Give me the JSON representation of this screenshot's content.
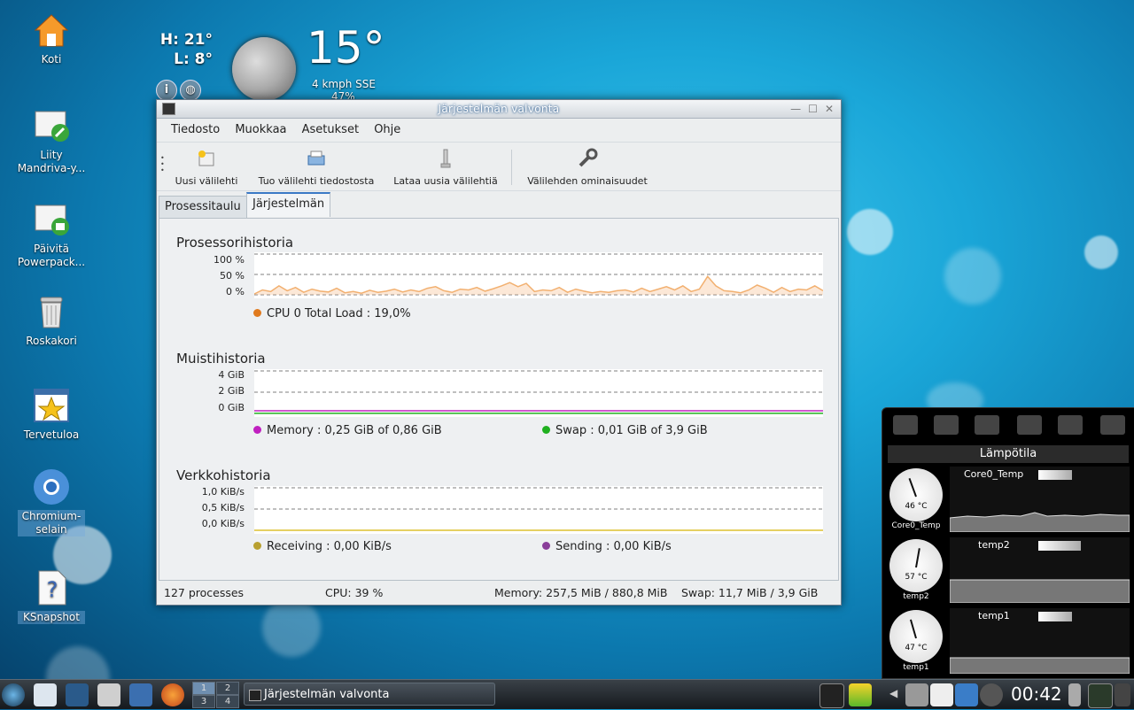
{
  "desktop": {
    "icons": [
      {
        "label": "Koti"
      },
      {
        "label": "Liity\nMandriva-y..."
      },
      {
        "label": "Päivitä\nPowerpack..."
      },
      {
        "label": "Roskakori"
      },
      {
        "label": "Tervetuloa"
      },
      {
        "label": "Chromium-\nselain"
      },
      {
        "label": "KSnapshot"
      }
    ]
  },
  "weather": {
    "high": "H: 21°",
    "low": "L: 8°",
    "temperature": "15°",
    "wind": "4 kmph SSE",
    "humidity": "47%"
  },
  "window": {
    "title": "Järjestelmän valvonta",
    "menu": [
      "Tiedosto",
      "Muokkaa",
      "Asetukset",
      "Ohje"
    ],
    "toolbar": {
      "new_tab": "Uusi välilehti",
      "import_tab": "Tuo välilehti tiedostosta",
      "download_tabs": "Lataa uusia välilehtiä",
      "tab_properties": "Välilehden ominaisuudet"
    },
    "tabs": [
      "Prosessitaulu",
      "Järjestelmän kuorma"
    ],
    "active_tab": "Järjestelmän kuorma",
    "cpu": {
      "title": "Prosessorihistoria",
      "y_labels": [
        "100 %",
        "50 %",
        "0 %"
      ],
      "legend": "CPU 0 Total Load : 19,0%",
      "color": "#e07a1e"
    },
    "memory": {
      "title": "Muistihistoria",
      "y_labels": [
        "4 GiB",
        "2 GiB",
        "0 GiB"
      ],
      "legend_memory": "Memory : 0,25 GiB of 0,86 GiB",
      "legend_swap": "Swap : 0,01 GiB of 3,9 GiB",
      "memory_color": "#c020c0",
      "swap_color": "#20b020"
    },
    "network": {
      "title": "Verkkohistoria",
      "y_labels": [
        "1,0 KiB/s",
        "0,5 KiB/s",
        "0,0 KiB/s"
      ],
      "legend_receiving": "Receiving : 0,00 KiB/s",
      "legend_sending": "Sending : 0,00 KiB/s",
      "receiving_color": "#b8a030",
      "sending_color": "#8a3e9a"
    },
    "status": {
      "processes": "127 processes",
      "cpu": "CPU: 39 %",
      "memory": "Memory: 257,5 MiB / 880,8 MiB",
      "swap": "Swap: 11,7 MiB / 3,9 GiB"
    }
  },
  "sensors": {
    "title": "Lämpötila",
    "items": [
      {
        "name": "Core0_Temp",
        "value": "46 °C",
        "label": "Core0_Temp"
      },
      {
        "name": "temp2",
        "value": "57 °C",
        "label": "temp2"
      },
      {
        "name": "temp1",
        "value": "47 °C",
        "label": "temp1"
      }
    ]
  },
  "taskbar": {
    "pager": [
      "1",
      "2",
      "3",
      "4"
    ],
    "task": "Järjestelmän valvonta",
    "clock": "00:42"
  },
  "chart_data": [
    {
      "type": "area",
      "title": "Prosessorihistoria",
      "ylabel": "",
      "ylim": [
        0,
        100
      ],
      "series": [
        {
          "name": "CPU 0 Total Load",
          "values": [
            2,
            12,
            8,
            22,
            10,
            18,
            6,
            14,
            9,
            7,
            16,
            5,
            8,
            4,
            11,
            6,
            9,
            14,
            7,
            12,
            8,
            16,
            20,
            10,
            6,
            14,
            12,
            18,
            9,
            15,
            22,
            30,
            20,
            28,
            8,
            12,
            10,
            18,
            6,
            14,
            9,
            5,
            8,
            6,
            10,
            12,
            7,
            16,
            8,
            14,
            20,
            12,
            22,
            8,
            14,
            45,
            22,
            10,
            8,
            5,
            12,
            24,
            16,
            6,
            18,
            8,
            14,
            12,
            22,
            10
          ]
        }
      ]
    },
    {
      "type": "line",
      "title": "Muistihistoria",
      "ylabel": "",
      "ylim": [
        0,
        4
      ],
      "series": [
        {
          "name": "Memory",
          "values": [
            0.25,
            0.25,
            0.25,
            0.25,
            0.25,
            0.25,
            0.25,
            0.25,
            0.25,
            0.25
          ]
        },
        {
          "name": "Swap",
          "values": [
            0.01,
            0.01,
            0.01,
            0.01,
            0.01,
            0.01,
            0.01,
            0.01,
            0.01,
            0.01
          ]
        }
      ]
    },
    {
      "type": "line",
      "title": "Verkkohistoria",
      "ylabel": "",
      "ylim": [
        0,
        1.0
      ],
      "series": [
        {
          "name": "Receiving",
          "values": [
            0,
            0,
            0,
            0,
            0,
            0,
            0,
            0,
            0,
            0
          ]
        },
        {
          "name": "Sending",
          "values": [
            0,
            0,
            0,
            0,
            0,
            0,
            0,
            0,
            0,
            0
          ]
        }
      ]
    }
  ]
}
